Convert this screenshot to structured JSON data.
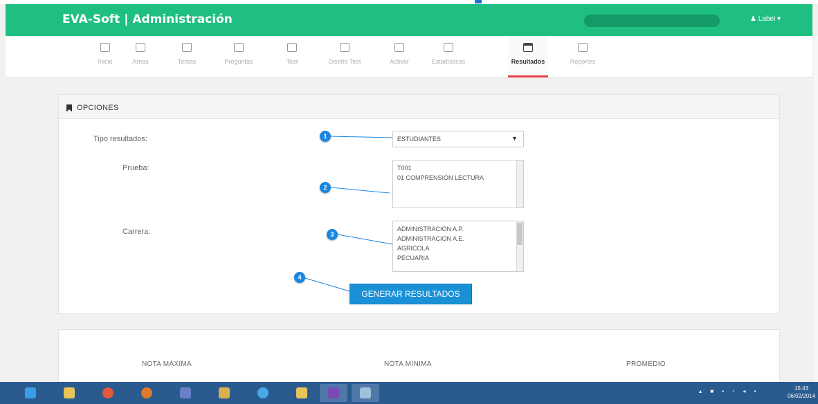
{
  "navbar": {
    "brand": "EVA-Soft | Administración",
    "user_label": "♟ Label ▾",
    "accent_color": "#1fbf82"
  },
  "toolbar": {
    "items": [
      {
        "label": "Inicio",
        "icon": "dashboard-icon"
      },
      {
        "label": "Areas",
        "icon": "edit-icon"
      },
      {
        "label": "Temas",
        "icon": "list-icon"
      },
      {
        "label": "Preguntas",
        "icon": "checkbox-icon"
      },
      {
        "label": "Test",
        "icon": "book-icon"
      },
      {
        "label": "Diseño Test",
        "icon": "wrench-icon"
      },
      {
        "label": "Activar",
        "icon": "user-icon"
      },
      {
        "label": "Estadísticas",
        "icon": "chart-icon"
      },
      {
        "label": "Resultados",
        "icon": "calendar-icon",
        "active": true
      },
      {
        "label": "Reportes",
        "icon": "chart-icon"
      }
    ]
  },
  "options_panel": {
    "title": "OPCIONES",
    "tipo_label": "Tipo resultados:",
    "tipo_value": "ESTUDIANTES",
    "prueba_label": "Prueba:",
    "prueba_items": [
      "T001",
      "01 COMPRENSIÓN LECTURA"
    ],
    "carrera_label": "Carrera:",
    "carrera_items": [
      "ADMINISTRACION A.P.",
      "ADMINISTRACION A.E.",
      "AGRICOLA",
      "PECUARIA"
    ],
    "generate_label": "GENERAR RESULTADOS",
    "callouts": [
      "1",
      "2",
      "3",
      "4"
    ]
  },
  "summary": {
    "max_label": "NOTA MÁXIMA",
    "min_label": "NOTA MÍNIMA",
    "avg_label": "PROMEDIO"
  },
  "taskbar": {
    "time": "15:43",
    "date": "06/02/2014"
  }
}
